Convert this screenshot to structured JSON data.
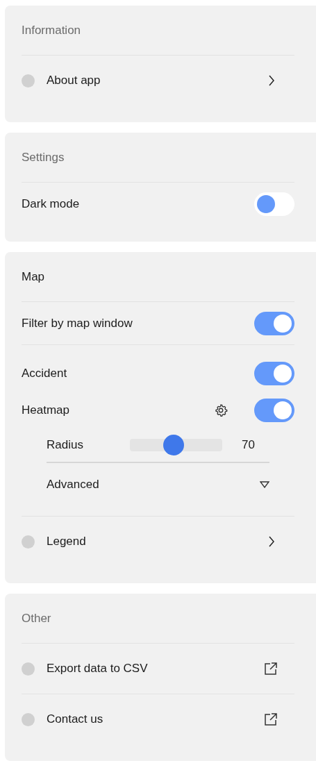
{
  "sections": [
    {
      "title": "Information",
      "muted": true,
      "groups": [
        [
          {
            "kind": "link",
            "label": "About app"
          }
        ]
      ]
    },
    {
      "title": "Settings",
      "muted": true,
      "groups": [
        [
          {
            "kind": "toggle",
            "label": "Dark mode",
            "on": false
          }
        ]
      ]
    },
    {
      "title": "Map",
      "muted": false,
      "groups": [
        [
          {
            "kind": "toggle",
            "label": "Filter by map window",
            "on": true
          }
        ],
        [
          {
            "kind": "toggle",
            "label": "Accident",
            "on": true
          },
          {
            "kind": "toggle",
            "label": "Heatmap",
            "on": true,
            "settings": true,
            "children": [
              {
                "kind": "slider",
                "label": "Radius",
                "level": 0.47,
                "reading": "70"
              },
              {
                "kind": "dropdown",
                "label": "Advanced"
              }
            ]
          }
        ],
        [
          {
            "kind": "link",
            "label": "Legend"
          }
        ]
      ]
    },
    {
      "title": "Other",
      "muted": true,
      "groups": [
        [
          {
            "kind": "external",
            "label": "Export data to CSV"
          }
        ],
        [
          {
            "kind": "external",
            "label": "Contact us"
          }
        ]
      ]
    }
  ]
}
